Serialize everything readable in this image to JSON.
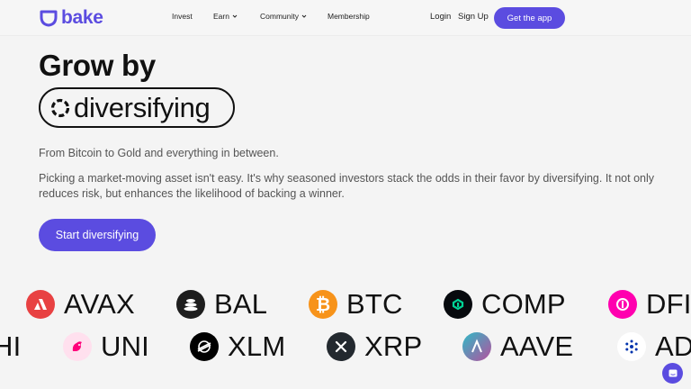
{
  "header": {
    "logo_text": "bake",
    "nav": [
      {
        "label": "Invest",
        "has_dropdown": false
      },
      {
        "label": "Earn",
        "has_dropdown": true
      },
      {
        "label": "Community",
        "has_dropdown": true
      },
      {
        "label": "Membership",
        "has_dropdown": false
      }
    ],
    "login_label": "Login",
    "signup_label": "Sign Up",
    "get_app_label": "Get the app"
  },
  "hero": {
    "title": "Grow by",
    "pill_word": "diversifying",
    "subtitle": "From Bitcoin to Gold and everything in between.",
    "body": "Picking a market-moving asset isn't easy. It's why seasoned investors stack the odds in their favor by diversifying. It not only reduces risk, but enhances the likelihood of backing a winner.",
    "cta_label": "Start diversifying"
  },
  "ticker": {
    "row1": [
      {
        "name": "AVAX",
        "icon": "avax-icon",
        "color": "#e84142"
      },
      {
        "name": "BAL",
        "icon": "bal-icon",
        "color": "#1e1e1e"
      },
      {
        "name": "BTC",
        "icon": "btc-icon",
        "color": "#f7931a"
      },
      {
        "name": "COMP",
        "icon": "comp-icon",
        "color": "#070a0e"
      },
      {
        "name": "DFI",
        "icon": "dfi-icon",
        "color": "#ff00af"
      }
    ],
    "row2": [
      {
        "name": "HI",
        "icon": "",
        "color": ""
      },
      {
        "name": "UNI",
        "icon": "uni-icon",
        "color": "#ff007a"
      },
      {
        "name": "XLM",
        "icon": "xlm-icon",
        "color": "#000000"
      },
      {
        "name": "XRP",
        "icon": "xrp-icon",
        "color": "#23292f"
      },
      {
        "name": "AAVE",
        "icon": "aave-icon",
        "color": "#9c5bd4"
      },
      {
        "name": "AD",
        "icon": "ada-icon",
        "color": "#0033ad"
      }
    ]
  },
  "colors": {
    "brand": "#5b4ce0",
    "background": "#f4f4f4",
    "text": "#111111",
    "muted_text": "#555555"
  },
  "chat": {
    "icon": "chat-icon"
  }
}
